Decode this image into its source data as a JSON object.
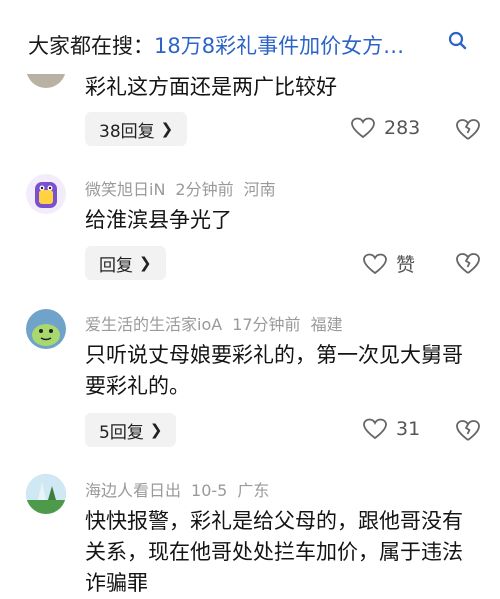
{
  "search": {
    "prefix": "大家都在搜：",
    "query": "18万8彩礼事件加价女方…"
  },
  "comments": [
    {
      "author": "",
      "time": "",
      "location": "",
      "text": "彩礼这方面还是两广比较好",
      "reply_label": "38回复",
      "likes": "283"
    },
    {
      "author": "微笑旭日iN",
      "time": "2分钟前",
      "location": "河南",
      "text": "给淮滨县争光了",
      "reply_label": "回复",
      "likes": "赞"
    },
    {
      "author": "爱生活的生活家ioA",
      "time": "17分钟前",
      "location": "福建",
      "text": "只听说丈母娘要彩礼的，第一次见大舅哥要彩礼的。",
      "reply_label": "5回复",
      "likes": "31"
    },
    {
      "author": "海边人看日出",
      "time": "10-5",
      "location": "广东",
      "text": "快快报警，彩礼是给父母的，跟他哥没有关系，现在他哥处处拦车加价，属于违法诈骗罪",
      "reply_label": "",
      "likes": ""
    }
  ],
  "icons": {
    "search": "search-icon",
    "like": "heart-icon",
    "dislike": "broken-heart-icon",
    "chevron": "chevron-right-icon"
  },
  "colors": {
    "link": "#2b63c7",
    "meta": "#9a9a9a",
    "reply_bg": "#f2f2f2"
  }
}
